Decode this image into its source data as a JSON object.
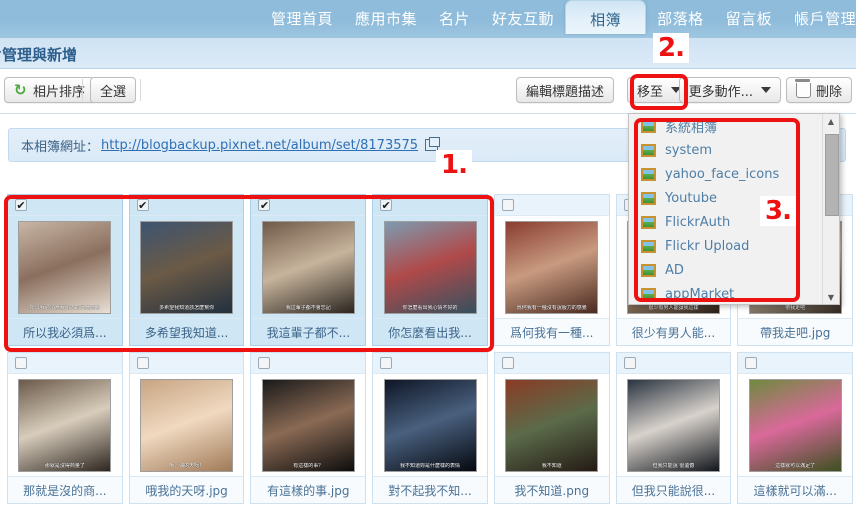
{
  "topnav": {
    "items": [
      {
        "label": "管理首頁",
        "active": false
      },
      {
        "label": "應用市集",
        "active": false
      },
      {
        "label": "名片",
        "active": false
      },
      {
        "label": "好友互動",
        "active": false
      },
      {
        "label": "相簿",
        "active": true
      },
      {
        "label": "部落格",
        "active": false
      },
      {
        "label": "留言板",
        "active": false
      },
      {
        "label": "帳戶管理",
        "active": false
      }
    ]
  },
  "page": {
    "title": "相片管理與新增"
  },
  "toolbar": {
    "sort_label": "相片排序",
    "select_all_label": "全選",
    "edit_title_label": "編輯標題描述",
    "move_to_label": "移至",
    "more_actions_label": "更多動作...",
    "delete_label": "刪除"
  },
  "urlbar": {
    "label": "本相簿網址：",
    "url": "http://blogbackup.pixnet.net/album/set/8173575",
    "copy_icon": "copy-icon"
  },
  "dropdown": {
    "items": [
      {
        "label": "系統相簿",
        "icon": "album-icon"
      },
      {
        "label": "system",
        "icon": "album-icon"
      },
      {
        "label": "yahoo_face_icons",
        "icon": "album-icon"
      },
      {
        "label": "Youtube",
        "icon": "album-icon"
      },
      {
        "label": "FlickrAuth",
        "icon": "album-icon"
      },
      {
        "label": "Flickr Upload",
        "icon": "album-icon"
      },
      {
        "label": "AD",
        "icon": "album-icon"
      },
      {
        "label": "appMarket",
        "icon": "album-icon"
      }
    ],
    "scroll_up_glyph": "▲",
    "scroll_down_glyph": "▼"
  },
  "annotations": [
    {
      "number": "1.",
      "target": "selected-photos-region"
    },
    {
      "number": "2.",
      "target": "move-to-button"
    },
    {
      "number": "3.",
      "target": "album-dropdown-list"
    }
  ],
  "grid": {
    "check_glyph": "✔",
    "rows": [
      [
        {
          "caption": "所以我必須爲...",
          "selected": true,
          "subtitle": "所以我必須爲我剛才的行爲道歉",
          "c1": "#c8b6a6",
          "c2": "#8b6f5e",
          "c3": "#e8e0d4"
        },
        {
          "caption": "多希望我知道...",
          "selected": true,
          "subtitle": "多希望我知道該怎麼幫你",
          "c1": "#3d5470",
          "c2": "#6b5a46",
          "c3": "#22303f"
        },
        {
          "caption": "我這輩子都不...",
          "selected": true,
          "subtitle": "我這輩子都不會忘記",
          "c1": "#6f5a48",
          "c2": "#c7b49c",
          "c3": "#2c2620"
        },
        {
          "caption": "你怎麼看出我...",
          "selected": true,
          "subtitle": "你怎麼看出我心情不好的",
          "c1": "#7c9bb0",
          "c2": "#b04a4a",
          "c3": "#35505f"
        },
        {
          "caption": "爲何我有一種...",
          "selected": false,
          "subtitle": "爲何我有一種沒有說服力的感覺",
          "c1": "#8a3d30",
          "c2": "#c89a80",
          "c3": "#4a2a20"
        },
        {
          "caption": "很少有男人能...",
          "selected": false,
          "subtitle": "很少有男人能讓我這樣",
          "c1": "#5a4638",
          "c2": "#b99c80",
          "c3": "#2a2018"
        },
        {
          "caption": "帶我走吧.jpg",
          "selected": false,
          "subtitle": "帶我走吧",
          "c1": "#7b6a5c",
          "c2": "#cbb9a4",
          "c3": "#30281f"
        }
      ],
      [
        {
          "caption": "那就是沒的商...",
          "selected": false,
          "subtitle": "那就是沒得商量了",
          "c1": "#6b5a4a",
          "c2": "#d8cdbc",
          "c3": "#2e2620"
        },
        {
          "caption": "哦我的天呀.jpg",
          "selected": false,
          "subtitle": "哦，偶的天呀！",
          "c1": "#c8a583",
          "c2": "#f0d9c0",
          "c3": "#a07a58"
        },
        {
          "caption": "有這樣的事.jpg",
          "selected": false,
          "subtitle": "有這樣的事？",
          "c1": "#1a1a1a",
          "c2": "#8a6a54",
          "c3": "#0d0d0d"
        },
        {
          "caption": "對不起我不知...",
          "selected": false,
          "subtitle": "我不知道妳是什麼樣的表情",
          "c1": "#0f1626",
          "c2": "#49607e",
          "c3": "#05080f"
        },
        {
          "caption": "我不知道.png",
          "selected": false,
          "subtitle": "我不知道",
          "c1": "#8a3c25",
          "c2": "#5b6b4a",
          "c3": "#241a14"
        },
        {
          "caption": "但我只能說很...",
          "selected": false,
          "subtitle": "但我只能說 很遺憾",
          "c1": "#2a3440",
          "c2": "#d8d2cc",
          "c3": "#12161c"
        },
        {
          "caption": "這樣就可以滿...",
          "selected": false,
          "subtitle": "這樣就可以滿足了",
          "c1": "#6f8a3f",
          "c2": "#d9699a",
          "c3": "#3c5020"
        }
      ]
    ]
  }
}
